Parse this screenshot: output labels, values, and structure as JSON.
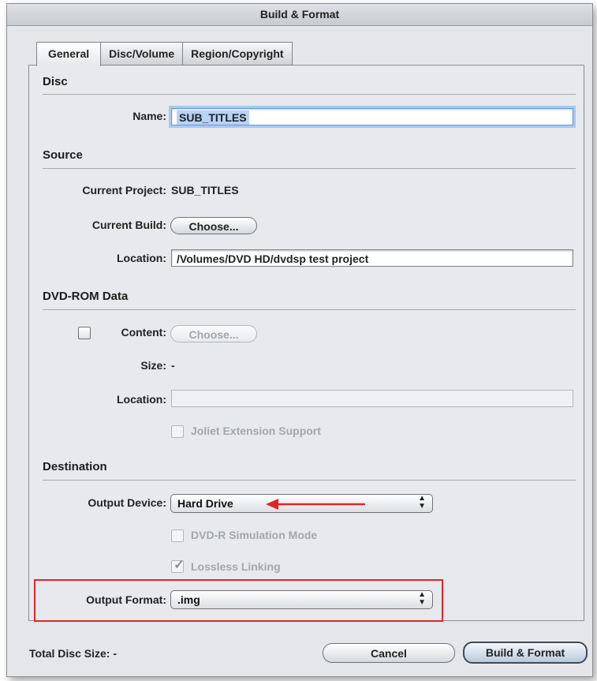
{
  "window": {
    "title": "Build & Format"
  },
  "tabs": [
    {
      "label": "General",
      "active": true
    },
    {
      "label": "Disc/Volume",
      "active": false
    },
    {
      "label": "Region/Copyright",
      "active": false
    }
  ],
  "disc": {
    "section_title": "Disc",
    "name_label": "Name:",
    "name_value": "SUB_TITLES"
  },
  "source": {
    "section_title": "Source",
    "current_project_label": "Current Project:",
    "current_project_value": "SUB_TITLES",
    "current_build_label": "Current Build:",
    "choose_label": "Choose...",
    "location_label": "Location:",
    "location_value": "/Volumes/DVD HD/dvdsp test project"
  },
  "dvd_rom": {
    "section_title": "DVD-ROM Data",
    "content_label": "Content:",
    "content_checked": false,
    "choose_label": "Choose...",
    "size_label": "Size:",
    "size_value": "-",
    "location_label": "Location:",
    "location_value": "",
    "joliet_label": "Joliet Extension Support",
    "joliet_checked": false
  },
  "destination": {
    "section_title": "Destination",
    "output_device_label": "Output Device:",
    "output_device_value": "Hard Drive",
    "dvdr_sim_label": "DVD-R Simulation Mode",
    "dvdr_sim_checked": false,
    "lossless_label": "Lossless Linking",
    "lossless_checked": true,
    "output_format_label": "Output Format:",
    "output_format_value": ".img"
  },
  "footer": {
    "total_disc_size_label": "Total Disc Size:",
    "total_disc_size_value": "-",
    "cancel_label": "Cancel",
    "build_format_label": "Build & Format"
  },
  "colors": {
    "annotation_red": "#e0242b",
    "focus_ring": "#a9c8ef"
  },
  "icons": {
    "popup_arrows": "up-down-chevron-icon",
    "annotation_arrow": "red-arrow-icon",
    "checkmark": "checkmark-icon"
  }
}
